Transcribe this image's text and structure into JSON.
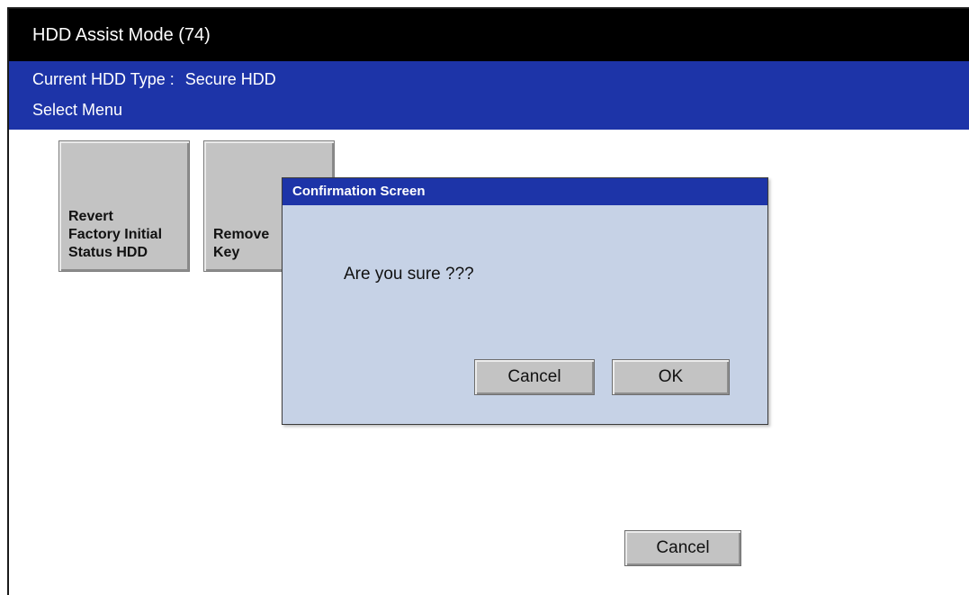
{
  "window": {
    "title": "HDD Assist Mode (74)"
  },
  "info": {
    "hdd_type_label": "Current HDD Type :",
    "hdd_type_value": "Secure HDD",
    "select_menu": "Select Menu"
  },
  "menu": {
    "items": [
      {
        "label": "Revert\nFactory Initial\nStatus HDD"
      },
      {
        "label": "Remove\nKey"
      }
    ]
  },
  "dialog": {
    "title": "Confirmation Screen",
    "message": "Are you sure ???",
    "cancel_label": "Cancel",
    "ok_label": "OK"
  },
  "footer": {
    "cancel_label": "Cancel"
  },
  "colors": {
    "title_bar": "#000000",
    "accent_blue": "#1d34a8",
    "dialog_bg": "#c6d2e6",
    "button_gray": "#c3c3c3"
  }
}
